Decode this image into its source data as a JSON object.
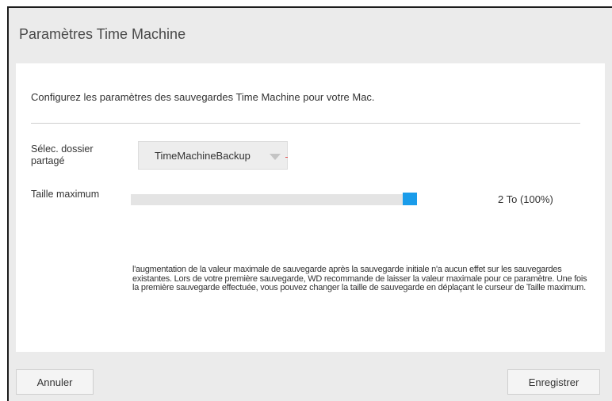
{
  "dialog": {
    "title": "Paramètres Time Machine",
    "intro": "Configurez les paramètres des sauvegardes Time Machine pour votre Mac.",
    "share": {
      "label": "Sélec. dossier partagé",
      "selected": "TimeMachineBackup"
    },
    "size": {
      "label": "Taille maximum",
      "value_text": "2 To (100%)",
      "percent": 100
    },
    "note": "l'augmentation de la valeur maximale de sauvegarde après la sauvegarde initiale n'a aucun effet sur les sauvegardes existantes. Lors de votre première sauvegarde, WD recommande de laisser la valeur maximale pour ce paramètre. Une fois la première sauvegarde effectuée, vous pouvez changer la taille de sauvegarde en déplaçant le curseur de Taille maximum.",
    "buttons": {
      "cancel": "Annuler",
      "save": "Enregistrer"
    }
  },
  "colors": {
    "accent": "#1a9cea",
    "panel": "#ffffff",
    "background": "#ebebeb"
  },
  "icons": {
    "select_arrow": "chevron-down-icon"
  }
}
